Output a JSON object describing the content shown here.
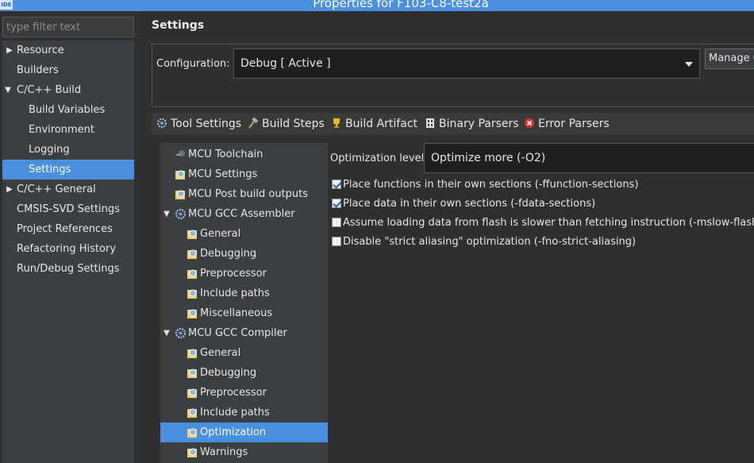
{
  "window": {
    "app_badge": "IDE",
    "title": "Properties for F103-C8-test2a"
  },
  "filter": {
    "placeholder": "type filter text"
  },
  "nav": {
    "items": [
      {
        "label": "Resource",
        "arrow": "▶"
      },
      {
        "label": "Builders",
        "arrow": ""
      },
      {
        "label": "C/C++ Build",
        "arrow": "▼"
      },
      {
        "label": "Build Variables",
        "arrow": ""
      },
      {
        "label": "Environment",
        "arrow": ""
      },
      {
        "label": "Logging",
        "arrow": ""
      },
      {
        "label": "Settings",
        "arrow": ""
      },
      {
        "label": "C/C++ General",
        "arrow": "▶"
      },
      {
        "label": "CMSIS-SVD Settings",
        "arrow": ""
      },
      {
        "label": "Project References",
        "arrow": ""
      },
      {
        "label": "Refactoring History",
        "arrow": ""
      },
      {
        "label": "Run/Debug Settings",
        "arrow": ""
      }
    ]
  },
  "settings": {
    "title": "Settings",
    "configuration_label": "Configuration:",
    "configuration_value": "Debug  [ Active ]",
    "manage_button": "Manage Configurations..."
  },
  "tabs": [
    {
      "label": "Tool Settings",
      "icon": "gear-icon"
    },
    {
      "label": "Build Steps",
      "icon": "hammer-icon"
    },
    {
      "label": "Build Artifact",
      "icon": "trophy-icon"
    },
    {
      "label": "Binary Parsers",
      "icon": "binary-icon"
    },
    {
      "label": "Error Parsers",
      "icon": "error-icon"
    }
  ],
  "tool_tree": [
    {
      "label": "MCU Toolchain",
      "arrow": ""
    },
    {
      "label": "MCU Settings",
      "arrow": ""
    },
    {
      "label": "MCU Post build outputs",
      "arrow": ""
    },
    {
      "label": "MCU GCC Assembler",
      "arrow": "▼"
    },
    {
      "label": "General",
      "arrow": ""
    },
    {
      "label": "Debugging",
      "arrow": ""
    },
    {
      "label": "Preprocessor",
      "arrow": ""
    },
    {
      "label": "Include paths",
      "arrow": ""
    },
    {
      "label": "Miscellaneous",
      "arrow": ""
    },
    {
      "label": "MCU GCC Compiler",
      "arrow": "▼"
    },
    {
      "label": "General",
      "arrow": ""
    },
    {
      "label": "Debugging",
      "arrow": ""
    },
    {
      "label": "Preprocessor",
      "arrow": ""
    },
    {
      "label": "Include paths",
      "arrow": ""
    },
    {
      "label": "Optimization",
      "arrow": ""
    },
    {
      "label": "Warnings",
      "arrow": ""
    }
  ],
  "optimization": {
    "level_label": "Optimization level",
    "level_value": "Optimize more (-O2)",
    "options": [
      {
        "label": "Place functions in their own sections (-ffunction-sections)",
        "checked": true
      },
      {
        "label": "Place data in their own sections (-fdata-sections)",
        "checked": true
      },
      {
        "label": "Assume loading data from flash is slower than fetching instruction (-mslow-flash-data)",
        "checked": false
      },
      {
        "label": "Disable \"strict aliasing\" optimization (-fno-strict-aliasing)",
        "checked": false
      }
    ]
  },
  "colors": {
    "accent": "#4a8fe0",
    "background": "#2f2f2f",
    "panel": "#3c3f41"
  }
}
